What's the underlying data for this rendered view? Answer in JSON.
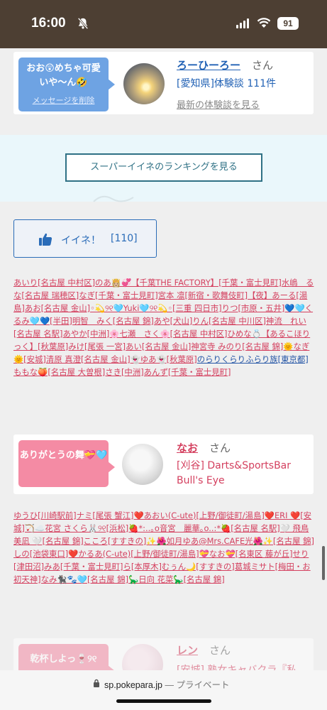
{
  "status_bar": {
    "time": "16:00",
    "battery": "91"
  },
  "card1": {
    "bubble_text": "おお😲めちゃ可愛いや〜ん🤣",
    "delete_label": "メッセージを削除",
    "user_name": "ろーひーろー",
    "honorific": "さん",
    "info": "[愛知県]体験談 111件",
    "latest_link": "最新の体験談を見る"
  },
  "ranking": {
    "button_label": "スーパーイイネのランキングを見る"
  },
  "iine": {
    "label": "イイネ！",
    "count": "[110]"
  },
  "likers1": [
    "あいり[名古屋 中村区]のあ👸🏼💞【千葉THE FACTORY】[千葉・富士見町]",
    "水嶋　るな[名古屋 瑞穂区]なぎ[千葉・富士見町]宮本 凛[新宿・歌舞伎町]",
    "【夜】あーる[湯島]あお[名古屋 金山]◦💫୨୧🩵Yuki🩵୨୧💫◦[三重 四日市]",
    "りつ[市原・五井]💙🩵くるみ🩵💙[半田]明智　みく[名古屋 錦]あや[犬山]",
    "りん[名古屋 中川区]神流　れい[名古屋 名駅]あやか[中洲]🌸七瀬　さく🌸",
    "[名古屋 中村区]ひめな💍【あるこほりっく】[秋葉原]みけ[尾張 一宮]",
    "あい[名古屋 金山]神宮寺 みのり[名古屋 錦]🌞なぎ🌞[安城]清原 真澄",
    "[名古屋 金山]👻ゆあ👻[秋葉原]",
    "のらりくらりふらり族[東京都]",
    "ももな🍑[名古屋 大曽根]さき[中洲]あんず[千葉・富士見町]"
  ],
  "card2": {
    "bubble_text": "ありがとうの舞💝🩵",
    "user_name": "なお",
    "honorific": "さん",
    "info_line1": "[刈谷] Darts&SportsBar",
    "info_line2": "Bull's Eye"
  },
  "likers2": [
    "ゆうひ[川崎駅前]ナミ[尾張 蟹江]❤️あおい(C-ute)[上野/御徒町/湯島]❤️",
    "ERI ❤️[安城]🏹☁️花宮 さくら🐰୨୧[浜松]🍓*:..｡o音宮　麗華｡o..:*🍓",
    "[名古屋 名駅]🤍 飛鳥 美凪 🤍[名古屋 錦]こころ[すすきの]✨🌺如月ゆあ",
    "@Mrs.CAFE光🌺✨[名古屋 錦]しの[池袋東口]❤️かるあ(C-ute)[上野/御徒町/湯島]",
    "💝なお💝[名東区 藤が丘]せり[津田沼]みあ[千葉・富士見町]ら[本厚木]",
    "むぅん🌙[すすきの]葛城ミサト[梅田・お初天神]なみ🐈‍⬛🐾🩵",
    "[名古屋 錦]🦕日向 花菜🦕[名古屋 錦]"
  ],
  "card3": {
    "bubble_text": "乾杯しよっ🍷୨୧",
    "user_name": "レン",
    "honorific": "さん",
    "info": "[安城] 熟女キャバクラ『私"
  },
  "url_bar": {
    "domain": "sp.pokepara.jp",
    "suffix": " — プライベート"
  }
}
